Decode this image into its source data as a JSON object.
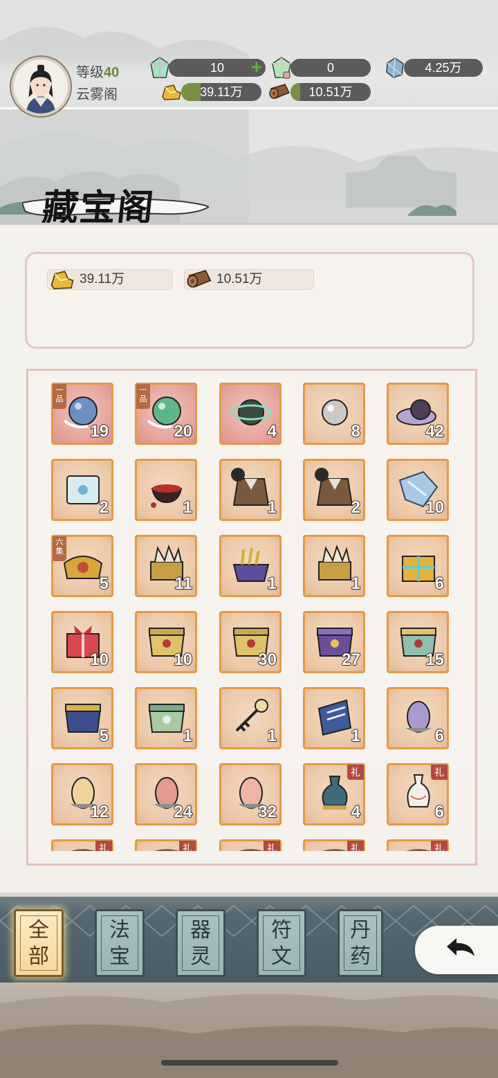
{
  "player": {
    "level_label": "等级",
    "level_value": "40",
    "sect_name": "云雾阁"
  },
  "resources": {
    "spirit_crystal": "10",
    "bound_crystal": "0",
    "spirit_stone": "4.25万",
    "gold": "39.11万",
    "wood": "10.51万"
  },
  "page": {
    "title": "藏宝阁"
  },
  "wallet": {
    "gold": "39.11万",
    "wood": "10.51万"
  },
  "items": [
    {
      "count": "19",
      "tag": "一品",
      "bg": "red",
      "icon": "blue-orb-icon"
    },
    {
      "count": "20",
      "tag": "一品",
      "bg": "red",
      "icon": "green-orb-icon"
    },
    {
      "count": "4",
      "bg": "red",
      "icon": "dark-orb-icon"
    },
    {
      "count": "8",
      "icon": "grey-pearl-icon"
    },
    {
      "count": "42",
      "icon": "purple-orb-icon"
    },
    {
      "count": "2",
      "icon": "jade-scroll-icon"
    },
    {
      "count": "1",
      "icon": "blood-bowl-icon"
    },
    {
      "count": "1",
      "icon": "robe-armor-icon"
    },
    {
      "count": "2",
      "icon": "robe-armor-icon"
    },
    {
      "count": "10",
      "icon": "blue-cloth-icon"
    },
    {
      "count": "5",
      "tag": "六集",
      "icon": "golden-chest-icon"
    },
    {
      "count": "11",
      "icon": "scroll-chest-icon"
    },
    {
      "count": "1",
      "icon": "treasure-box-icon"
    },
    {
      "count": "1",
      "icon": "scroll-chest-icon"
    },
    {
      "count": "6",
      "icon": "gold-gift-icon"
    },
    {
      "count": "10",
      "icon": "red-gift-icon"
    },
    {
      "count": "10",
      "icon": "gold-chest-icon"
    },
    {
      "count": "30",
      "icon": "gold-chest-icon"
    },
    {
      "count": "27",
      "icon": "purple-chest-icon"
    },
    {
      "count": "15",
      "icon": "jade-chest-icon"
    },
    {
      "count": "5",
      "icon": "blue-chest-icon"
    },
    {
      "count": "1",
      "icon": "green-chest-icon"
    },
    {
      "count": "1",
      "icon": "key-icon"
    },
    {
      "count": "1",
      "icon": "blue-scroll-icon"
    },
    {
      "count": "6",
      "icon": "purple-egg-icon"
    },
    {
      "count": "12",
      "icon": "yellow-egg-icon"
    },
    {
      "count": "24",
      "icon": "red-egg-icon"
    },
    {
      "count": "32",
      "icon": "pink-egg-icon"
    },
    {
      "count": "4",
      "gift": "礼",
      "icon": "jade-vase-icon"
    },
    {
      "count": "6",
      "gift": "礼",
      "icon": "porcelain-vase-icon"
    },
    {
      "count": "",
      "gift": "礼",
      "icon": "partial-item-icon"
    },
    {
      "count": "",
      "gift": "礼",
      "icon": "partial-item-icon"
    },
    {
      "count": "",
      "gift": "礼",
      "icon": "partial-item-icon"
    },
    {
      "count": "",
      "gift": "礼",
      "icon": "partial-item-icon"
    },
    {
      "count": "",
      "gift": "礼",
      "icon": "partial-item-icon"
    }
  ],
  "tabs": [
    {
      "label_top": "全",
      "label_bottom": "部",
      "active": true
    },
    {
      "label_top": "法",
      "label_bottom": "宝",
      "active": false
    },
    {
      "label_top": "器",
      "label_bottom": "灵",
      "active": false
    },
    {
      "label_top": "符",
      "label_bottom": "文",
      "active": false
    },
    {
      "label_top": "丹",
      "label_bottom": "药",
      "active": false
    }
  ],
  "colors": {
    "item_border": "#e49a46",
    "item_bg": "#ecc8a8",
    "item_bg_rare": "#e5a39a",
    "tab_active": "#f4d89c",
    "tab_inactive": "#9cb4b8",
    "bar_fill": "#7a8f44"
  }
}
